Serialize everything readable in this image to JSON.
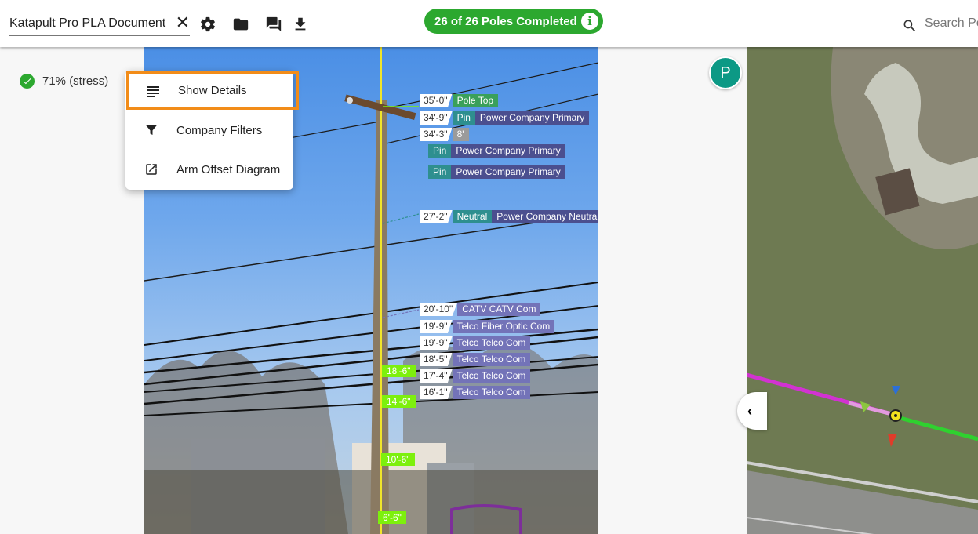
{
  "header": {
    "document_title": "Katapult Pro PLA Document",
    "progress": "26 of 26 Poles Completed",
    "info_glyph": "i",
    "search_placeholder": "Search Poles",
    "icons": [
      "close-icon",
      "settings-icon",
      "folder-icon",
      "chat-icon",
      "download-icon",
      "info-icon",
      "search-icon"
    ]
  },
  "status": {
    "text": "71% (stress)",
    "icon": "check-circle-icon"
  },
  "menu": {
    "items": [
      {
        "label": "Show Details",
        "icon": "notes-icon"
      },
      {
        "label": "Company Filters",
        "icon": "filter-icon"
      },
      {
        "label": "Arm Offset Diagram",
        "icon": "open-external-icon"
      }
    ]
  },
  "avatar": {
    "letter": "P",
    "color": "#0c9985"
  },
  "photo": {
    "tags": [
      {
        "height": "35'-0\"",
        "kind": "Pole Top",
        "company": ""
      },
      {
        "height": "34'-9\"",
        "kind": "Pin",
        "company": "Power Company Primary"
      },
      {
        "height": "34'-3\"",
        "kind": "8'",
        "company": ""
      },
      {
        "height": "",
        "kind": "Pin",
        "company": "Power Company Primary"
      },
      {
        "height": "",
        "kind": "Pin",
        "company": "Power Company Primary"
      },
      {
        "height": "27'-2\"",
        "kind": "Neutral",
        "company": "Power Company Neutral"
      },
      {
        "height": "20'-10\"",
        "kind": "CATV CATV Com",
        "company": ""
      },
      {
        "height": "19'-9\"",
        "kind": "Telco Fiber Optic Com",
        "company": ""
      },
      {
        "height": "19'-9\"",
        "kind": "Telco Telco Com",
        "company": ""
      },
      {
        "height": "18'-5\"",
        "kind": "Telco Telco Com",
        "company": ""
      },
      {
        "height": "17'-4\"",
        "kind": "Telco Telco Com",
        "company": ""
      },
      {
        "height": "16'-1\"",
        "kind": "Telco Telco Com",
        "company": ""
      }
    ],
    "height_markers": [
      "18'-6\"",
      "14'-6\"",
      "10'-6\"",
      "6'-6\""
    ]
  },
  "map": {
    "collapse_glyph": "‹"
  },
  "colors": {
    "accent_green": "#2ca82f",
    "highlight_orange": "#f28c18",
    "power_tag": "#2e8f8f",
    "power_company": "#4b4f8f",
    "telco_tag": "#7373b8",
    "height_marker": "#7df00d"
  }
}
